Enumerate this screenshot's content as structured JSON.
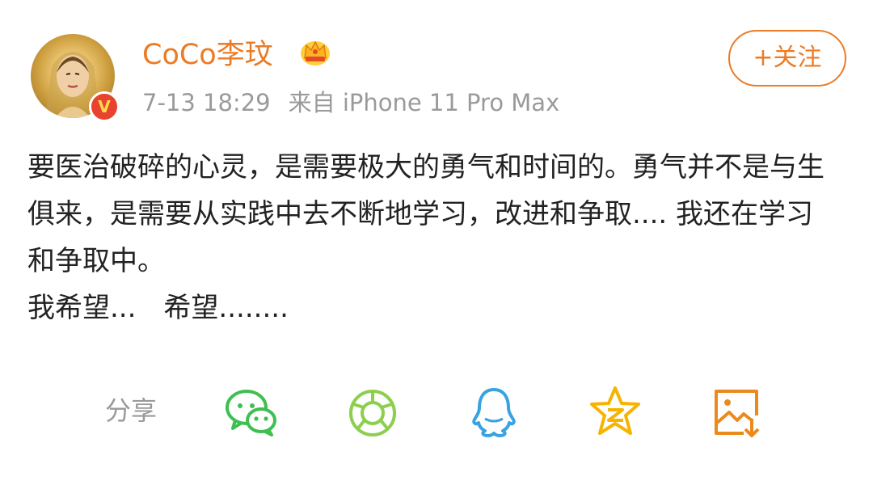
{
  "post": {
    "author": "CoCo李玟",
    "time": "7-13 18:29",
    "source": "来自 iPhone 11 Pro Max",
    "follow_label": "+关注",
    "verified_mark": "V",
    "paragraph_1": "要医治破碎的心灵，是需要极大的勇气和时间的。勇气并不是与生俱来，是需要从实践中去不断地学习，改进和争取.... 我还在学习和争取中。",
    "paragraph_2": "我希望... 希望........"
  },
  "share": {
    "label": "分享",
    "icons": [
      "wechat-icon",
      "wechat-moments-icon",
      "qq-icon",
      "qzone-icon",
      "save-image-icon"
    ]
  },
  "colors": {
    "accent": "#eb7b24",
    "meta_text": "#9a9a9a",
    "body_text": "#222222",
    "wechat": "#3fbf4f",
    "moments": "#8ccf4d",
    "qq": "#39a3e2",
    "qzone": "#f6b400",
    "save": "#eb8a1c"
  }
}
